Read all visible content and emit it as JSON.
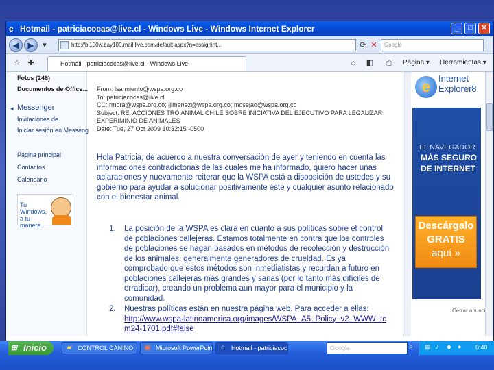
{
  "window": {
    "title": "Hotmail - patriciacocas@live.cl - Windows Live - Windows Internet Explorer",
    "address": "http://bl100w.bay100.mail.live.com/default.aspx?n=assignint...",
    "search_placeholder": "Google",
    "tab_title": "Hotmail - patriciacocas@live.cl - Windows Live",
    "page_label": "Página",
    "tools_label": "Herramientas"
  },
  "left_nav": {
    "fotos": "Fotos (246)",
    "docs": "Documentos de Office...",
    "messenger": "Messenger",
    "invitations": "Invitaciones de",
    "signin": "Iniciar sesión en Messenger",
    "home": "Página principal",
    "contacts": "Contactos",
    "calendar": "Calendario",
    "promo": "Tu Windows, a tu manera."
  },
  "email": {
    "from": "From: lsarmiento@wspa.org.co",
    "to": "To: patriciacocas@live.cl",
    "cc": "CC: rmora@wspa.org.co; jjimenez@wspa.org.co; mosejao@wspa.org.co",
    "subject": "Subject: RE: ACCIONES TRO ANIMAL CHILE SOBRE INICIATIVA DEL EJECUTIVO PARA LEGALIZAR EXPERIMINIO DE ANIMALES",
    "date": "Date: Tue, 27 Oct 2009 10:32:15 -0500",
    "body": "Hola Patricia, de acuerdo a nuestra conversación de ayer y teniendo en cuenta las informaciones contradictorias de las cuales me ha informado, quiero hacer unas aclaraciones y nuevamente reiterar que la WSPA está a disposición de ustedes y su gobierno para ayudar a solucionar positivamente éste y cualquier asunto relacionado con el bienestar animal.",
    "item1_num": "1.",
    "item1": "La posición de la WSPA es clara en cuanto a sus políticas sobre el control de poblaciones callejeras. Estamos totalmente en contra que los controles de poblaciones se hagan basados en métodos de recolección y destrucción de los animales, generalmente generadores de crueldad. Es ya comprobado que estos métodos son inmediatistas y recurdan a futuro en poblaciones callejeras más grandes y sanas (por lo tanto más difíciles de erradicar), creando un problema aun mayor para el municipio y la comunidad.",
    "item2_num": "2.",
    "item2": "Nuestras políticas están en nuestra página web. Para acceder a ellas:",
    "link": "http://www.wspa-latinoamerica.org/images/WSPA_A5_Policy_v2_WWW_tcm24-1701.pdf#false"
  },
  "ad": {
    "logo_prefix": "Internet",
    "logo_name": "Explorer8",
    "line1": "EL NAVEGADOR",
    "line2": "MÁS SEGURO",
    "line3": "DE INTERNET",
    "cta1": "Descárgalo",
    "cta2": "GRATIS",
    "cta3": "aquí",
    "caption": "Cerrar anuncio"
  },
  "taskbar": {
    "start": "Inicio",
    "task1": "CONTROL CANINO",
    "task2": "Microsoft PowerPoint...",
    "task3": "Hotmail - patriciacocas...",
    "search": "Google",
    "clock": "0:40"
  },
  "icons": {
    "back": "back-arrow-icon",
    "forward": "forward-arrow-icon",
    "refresh": "refresh-icon",
    "stop": "stop-icon",
    "home": "home-icon",
    "print": "printer-icon"
  }
}
